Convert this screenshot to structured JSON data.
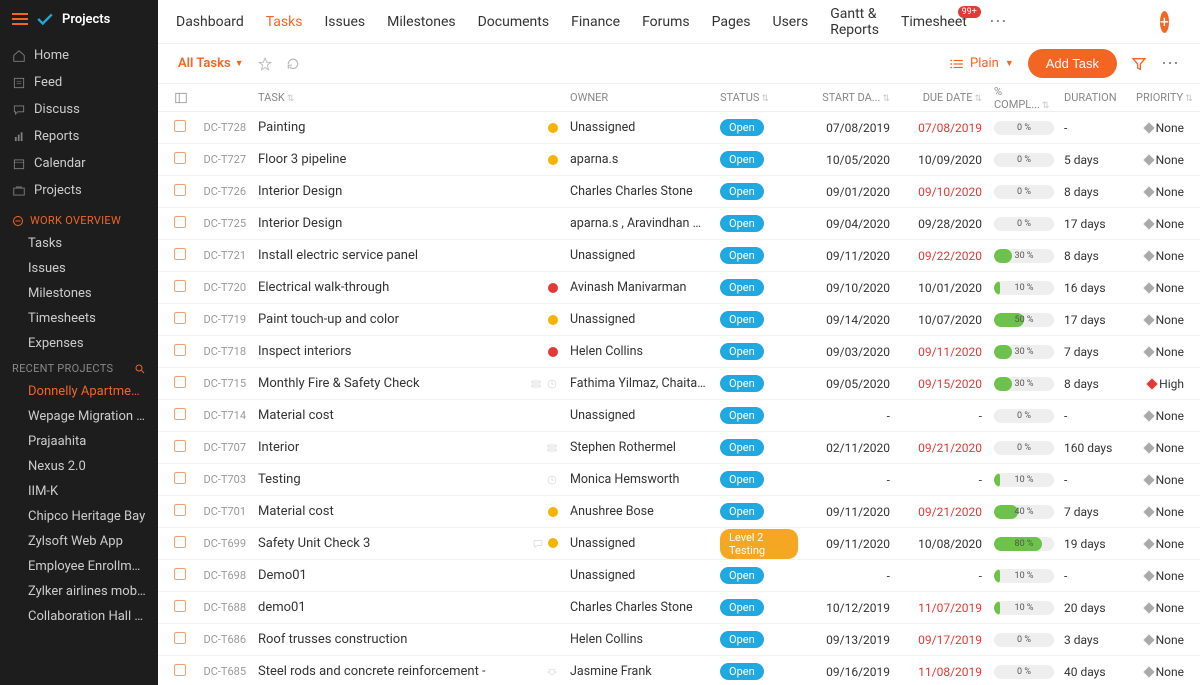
{
  "app_name": "Projects",
  "sidebar": {
    "main": [
      {
        "icon": "home-icon",
        "label": "Home"
      },
      {
        "icon": "feed-icon",
        "label": "Feed"
      },
      {
        "icon": "discuss-icon",
        "label": "Discuss"
      },
      {
        "icon": "reports-icon",
        "label": "Reports"
      },
      {
        "icon": "calendar-icon",
        "label": "Calendar"
      },
      {
        "icon": "projects-icon",
        "label": "Projects"
      }
    ],
    "work_overview_title": "WORK OVERVIEW",
    "work_overview": [
      "Tasks",
      "Issues",
      "Milestones",
      "Timesheets",
      "Expenses"
    ],
    "recent_title": "RECENT PROJECTS",
    "recent": [
      "Donnelly Apartments C",
      "Wepage Migration Pha",
      "Prajaahita",
      "Nexus 2.0",
      "IIM-K",
      "Chipco Heritage Bay",
      "Zylsoft Web App",
      "Employee Enrollment",
      "Zylker airlines mobile ap",
      "Collaboration Hall Cons"
    ]
  },
  "topnav": [
    "Dashboard",
    "Tasks",
    "Issues",
    "Milestones",
    "Documents",
    "Finance",
    "Forums",
    "Pages",
    "Users",
    "Gantt & Reports",
    "Timesheet"
  ],
  "topnav_active": 1,
  "timesheet_badge": "99+",
  "subbar": {
    "all_tasks": "All Tasks",
    "view": "Plain",
    "add_task": "Add Task"
  },
  "columns": {
    "task": "TASK",
    "owner": "OWNER",
    "status": "STATUS",
    "start": "START DA...",
    "due": "DUE DATE",
    "compl": "% COMPL...",
    "dur": "DURATION",
    "pri": "PRIORITY"
  },
  "tasks": [
    {
      "id": "DC-T728",
      "name": "Painting",
      "dot": "yellow",
      "owner": "Unassigned",
      "status": "Open",
      "start": "07/08/2019",
      "due": "07/08/2019",
      "due_red": true,
      "pct": 0,
      "dur": "-",
      "pri": "None"
    },
    {
      "id": "DC-T727",
      "name": "Floor 3 pipeline",
      "dot": "yellow",
      "owner": "aparna.s",
      "status": "Open",
      "start": "10/05/2020",
      "due": "10/09/2020",
      "pct": 0,
      "dur": "5 days",
      "pri": "None"
    },
    {
      "id": "DC-T726",
      "name": "Interior Design",
      "owner": "Charles Charles Stone",
      "status": "Open",
      "start": "09/01/2020",
      "due": "09/10/2020",
      "due_red": true,
      "pct": 0,
      "dur": "8 days",
      "pri": "None"
    },
    {
      "id": "DC-T725",
      "name": "Interior Design",
      "owner": "aparna.s , Aravindhan Rajendi",
      "status": "Open",
      "start": "09/04/2020",
      "due": "09/28/2020",
      "pct": 0,
      "dur": "17 days",
      "pri": "None"
    },
    {
      "id": "DC-T721",
      "name": "Install electric service panel",
      "owner": "Unassigned",
      "status": "Open",
      "start": "09/11/2020",
      "due": "09/22/2020",
      "due_red": true,
      "pct": 30,
      "dur": "8 days",
      "pri": "None"
    },
    {
      "id": "DC-T720",
      "name": "Electrical walk-through",
      "dot": "red",
      "owner": "Avinash Manivarman",
      "status": "Open",
      "start": "09/10/2020",
      "due": "10/01/2020",
      "pct": 10,
      "dur": "16 days",
      "pri": "None"
    },
    {
      "id": "DC-T719",
      "name": "Paint touch-up and color",
      "dot": "yellow",
      "owner": "Unassigned",
      "status": "Open",
      "start": "09/14/2020",
      "due": "10/07/2020",
      "pct": 50,
      "dur": "17 days",
      "pri": "None"
    },
    {
      "id": "DC-T718",
      "name": "Inspect interiors",
      "dot": "red",
      "owner": "Helen Collins",
      "status": "Open",
      "start": "09/03/2020",
      "due": "09/11/2020",
      "due_red": true,
      "pct": 30,
      "dur": "7 days",
      "pri": "None"
    },
    {
      "id": "DC-T715",
      "name": "Monthly Fire & Safety Check",
      "extra": [
        "recur",
        "clock"
      ],
      "owner": "Fathima Yilmaz, Chaitanya M…",
      "status": "Open",
      "start": "09/05/2020",
      "due": "09/15/2020",
      "due_red": true,
      "pct": 30,
      "dur": "8 days",
      "pri": "High"
    },
    {
      "id": "DC-T714",
      "name": "Material cost",
      "owner": "Unassigned",
      "status": "Open",
      "start": "-",
      "due": "-",
      "pct": 0,
      "dur": "-",
      "pri": "None"
    },
    {
      "id": "DC-T707",
      "name": "Interior",
      "extra": [
        "recur"
      ],
      "owner": "Stephen Rothermel",
      "status": "Open",
      "start": "02/11/2020",
      "due": "09/21/2020",
      "due_red": true,
      "pct": 0,
      "dur": "160 days",
      "pri": "None"
    },
    {
      "id": "DC-T703",
      "name": "Testing",
      "extra": [
        "clock"
      ],
      "owner": "Monica Hemsworth",
      "status": "Open",
      "start": "-",
      "due": "-",
      "pct": 10,
      "dur": "-",
      "pri": "None"
    },
    {
      "id": "DC-T701",
      "name": "Material cost",
      "dot": "yellow",
      "owner": "Anushree Bose",
      "status": "Open",
      "start": "09/11/2020",
      "due": "09/21/2020",
      "due_red": true,
      "pct": 40,
      "dur": "7 days",
      "pri": "None"
    },
    {
      "id": "DC-T699",
      "name": "Safety Unit Check 3",
      "extra": [
        "chat"
      ],
      "dot": "yellow",
      "owner": "Unassigned",
      "status": "Level 2 Testing",
      "status_style": "testing",
      "start": "09/11/2020",
      "due": "10/08/2020",
      "pct": 80,
      "dur": "19 days",
      "pri": "None"
    },
    {
      "id": "DC-T698",
      "name": "Demo01",
      "owner": "Unassigned",
      "status": "Open",
      "start": "-",
      "due": "-",
      "pct": 10,
      "dur": "-",
      "pri": "None"
    },
    {
      "id": "DC-T688",
      "name": "demo01",
      "owner": "Charles Charles Stone",
      "status": "Open",
      "start": "10/12/2019",
      "due": "11/07/2019",
      "due_red": true,
      "pct": 10,
      "dur": "20 days",
      "pri": "None"
    },
    {
      "id": "DC-T686",
      "name": "Roof trusses construction",
      "owner": "Helen Collins",
      "status": "Open",
      "start": "09/13/2019",
      "due": "09/17/2019",
      "due_red": true,
      "pct": 0,
      "dur": "3 days",
      "pri": "None"
    },
    {
      "id": "DC-T685",
      "name": "Steel rods and concrete reinforcement -",
      "extra": [
        "bug"
      ],
      "owner": "Jasmine Frank",
      "status": "Open",
      "start": "09/16/2019",
      "due": "11/08/2019",
      "due_red": true,
      "pct": 0,
      "dur": "40 days",
      "pri": "None"
    }
  ]
}
